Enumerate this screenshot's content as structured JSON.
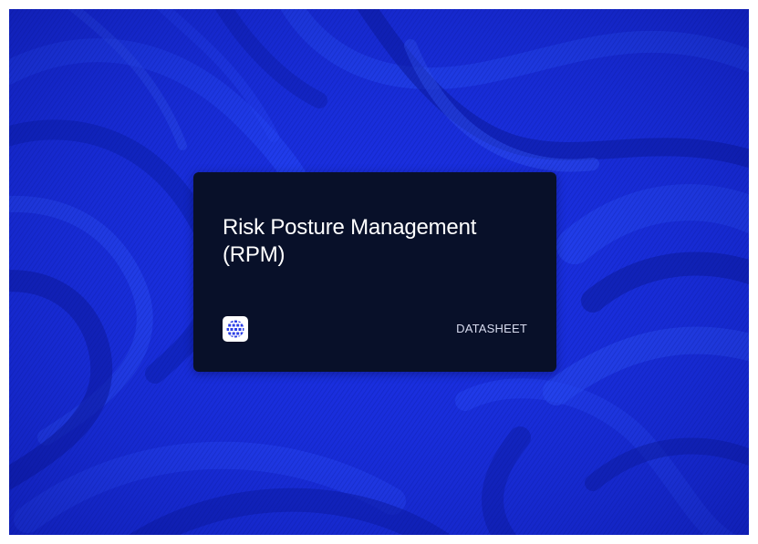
{
  "card": {
    "title": "Risk Posture Management (RPM)",
    "tag": "DATASHEET",
    "logo_icon": "globe-grid-logo-icon"
  },
  "colors": {
    "background_blue": "#1a2fe0",
    "card_background": "#081029",
    "title_text": "#ffffff",
    "tag_text": "#d8dcef",
    "logo_blue": "#2b3ee6"
  }
}
